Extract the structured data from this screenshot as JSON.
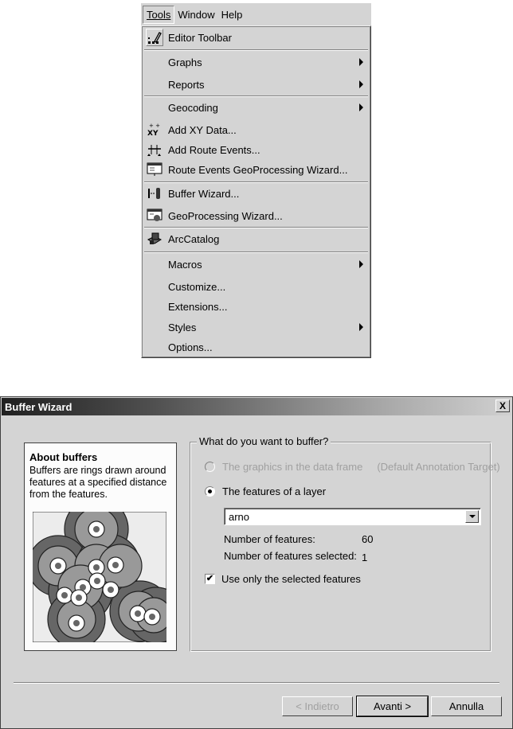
{
  "menubar": {
    "items": [
      {
        "label": "Tools",
        "active": true
      },
      {
        "label": "Window",
        "active": false
      },
      {
        "label": "Help",
        "active": false
      }
    ]
  },
  "tools_menu": {
    "items": [
      {
        "label": "Editor Toolbar",
        "icon": "editor-toolbar-icon",
        "submenu": false
      },
      {
        "label": "Graphs",
        "icon": null,
        "submenu": true
      },
      {
        "label": "Reports",
        "icon": null,
        "submenu": true
      },
      {
        "label": "Geocoding",
        "icon": null,
        "submenu": true
      },
      {
        "label": "Add XY Data...",
        "icon": "add-xy-data-icon",
        "submenu": false
      },
      {
        "label": "Add Route Events...",
        "icon": "add-route-events-icon",
        "submenu": false
      },
      {
        "label": "Route Events GeoProcessing Wizard...",
        "icon": "route-events-wizard-icon",
        "submenu": false
      },
      {
        "label": "Buffer Wizard...",
        "icon": "buffer-wizard-icon",
        "submenu": false
      },
      {
        "label": "GeoProcessing Wizard...",
        "icon": "geoprocessing-wizard-icon",
        "submenu": false
      },
      {
        "label": "ArcCatalog",
        "icon": "arccatalog-icon",
        "submenu": false
      },
      {
        "label": "Macros",
        "icon": null,
        "submenu": true
      },
      {
        "label": "Customize...",
        "icon": null,
        "submenu": false
      },
      {
        "label": "Extensions...",
        "icon": null,
        "submenu": false
      },
      {
        "label": "Styles",
        "icon": null,
        "submenu": true
      },
      {
        "label": "Options...",
        "icon": null,
        "submenu": false
      }
    ]
  },
  "dialog": {
    "title": "Buffer Wizard",
    "close_label": "X",
    "about": {
      "heading": "About buffers",
      "text": "Buffers are rings drawn around features at a specified distance from the features."
    },
    "group": {
      "legend": "What do you want to buffer?",
      "option_graphics": "The graphics in the data frame",
      "option_graphics_note": "(Default Annotation Target)",
      "option_graphics_enabled": false,
      "option_layer": "The features of a layer",
      "selected_option": "layer",
      "layer_value": "arno",
      "num_features_label": "Number of features:",
      "num_features_value": "60",
      "num_selected_label": "Number of features selected:",
      "num_selected_value": "1",
      "use_selected_label": "Use only the selected features",
      "use_selected_checked": true,
      "checkmark": "✔"
    },
    "buttons": {
      "back": "< Indietro",
      "next": "Avanti >",
      "cancel": "Annulla"
    }
  }
}
